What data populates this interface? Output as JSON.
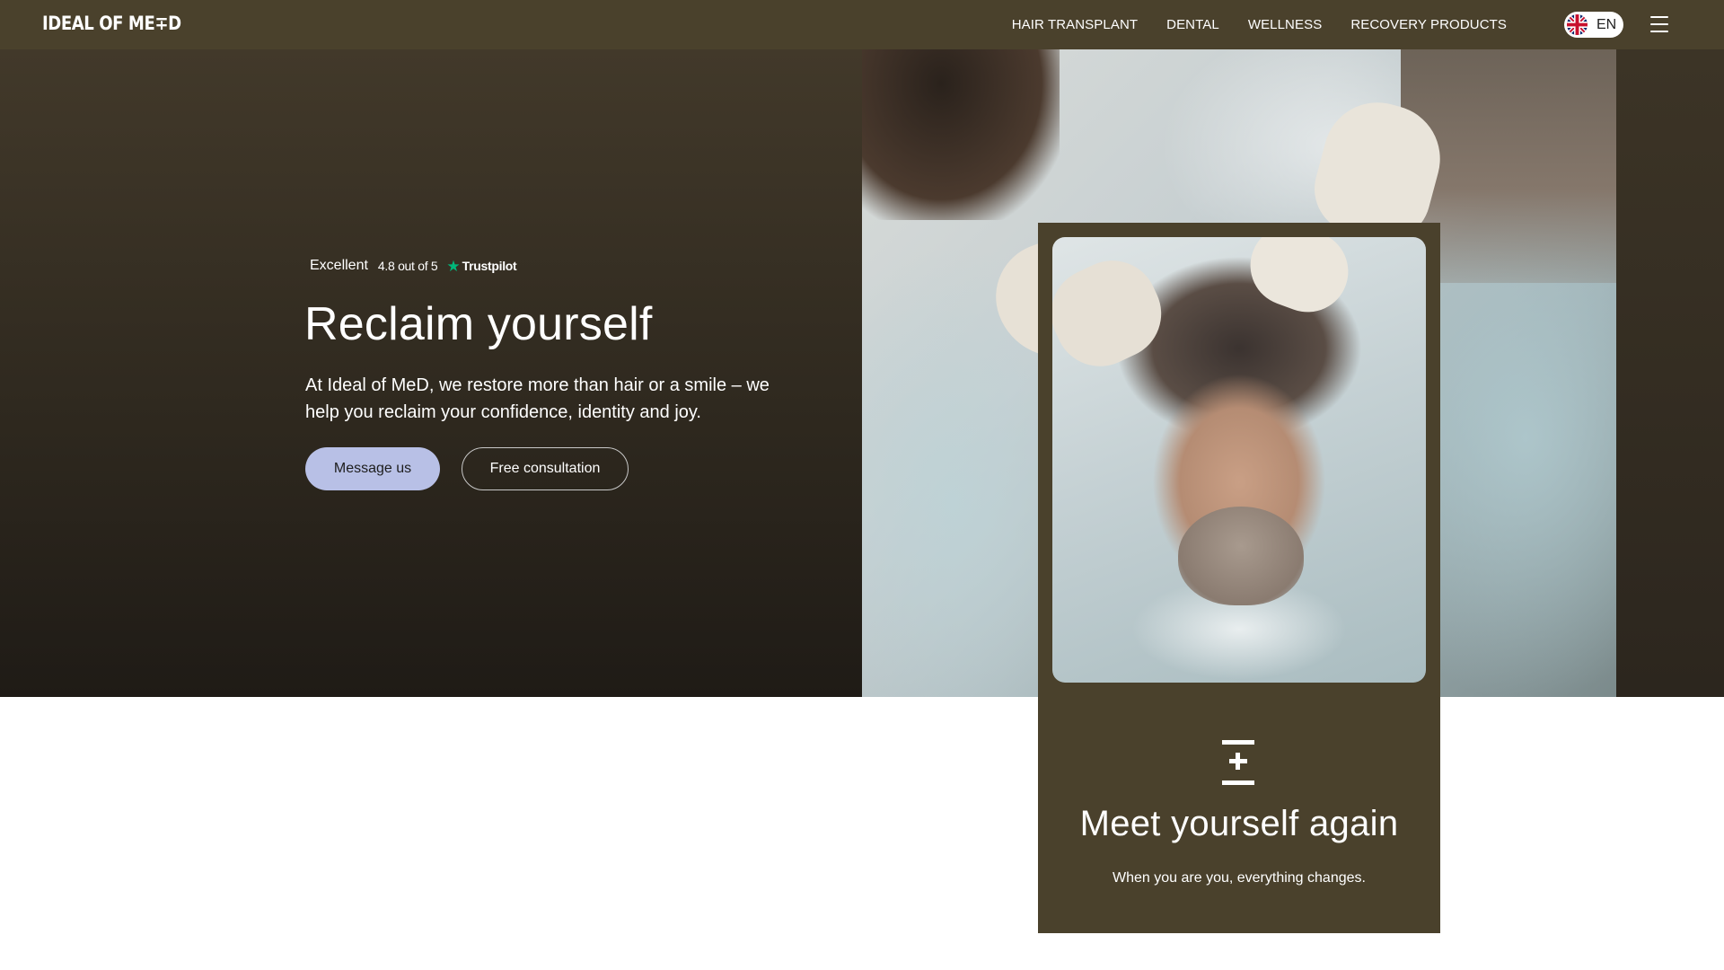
{
  "nav": {
    "logo": "IDEAL OF ME∓D",
    "links": [
      "HAIR TRANSPLANT",
      "DENTAL",
      "WELLNESS",
      "RECOVERY PRODUCTS"
    ],
    "language": "EN",
    "flag_icon": "uk-flag-icon",
    "menu_icon": "hamburger-menu-icon"
  },
  "hero": {
    "reviews": {
      "label": "Excellent",
      "rating": "4.8 out of 5",
      "provider": "Trustpilot",
      "star_icon": "trustpilot-star-icon",
      "star_color": "#00b67a"
    },
    "title": "Reclaim yourself",
    "description": "At Ideal of MeD, we restore more than hair or a smile – we help you reclaim your confidence, identity and joy.",
    "primary_button": "Message us",
    "secondary_button": "Free consultation"
  },
  "card": {
    "logo_icon": "brand-mark-icon",
    "title": "Meet yourself again",
    "subtitle": "When you are you, everything changes."
  },
  "colors": {
    "brand": "#4a412c",
    "primary_button": "#b8c0e6"
  }
}
